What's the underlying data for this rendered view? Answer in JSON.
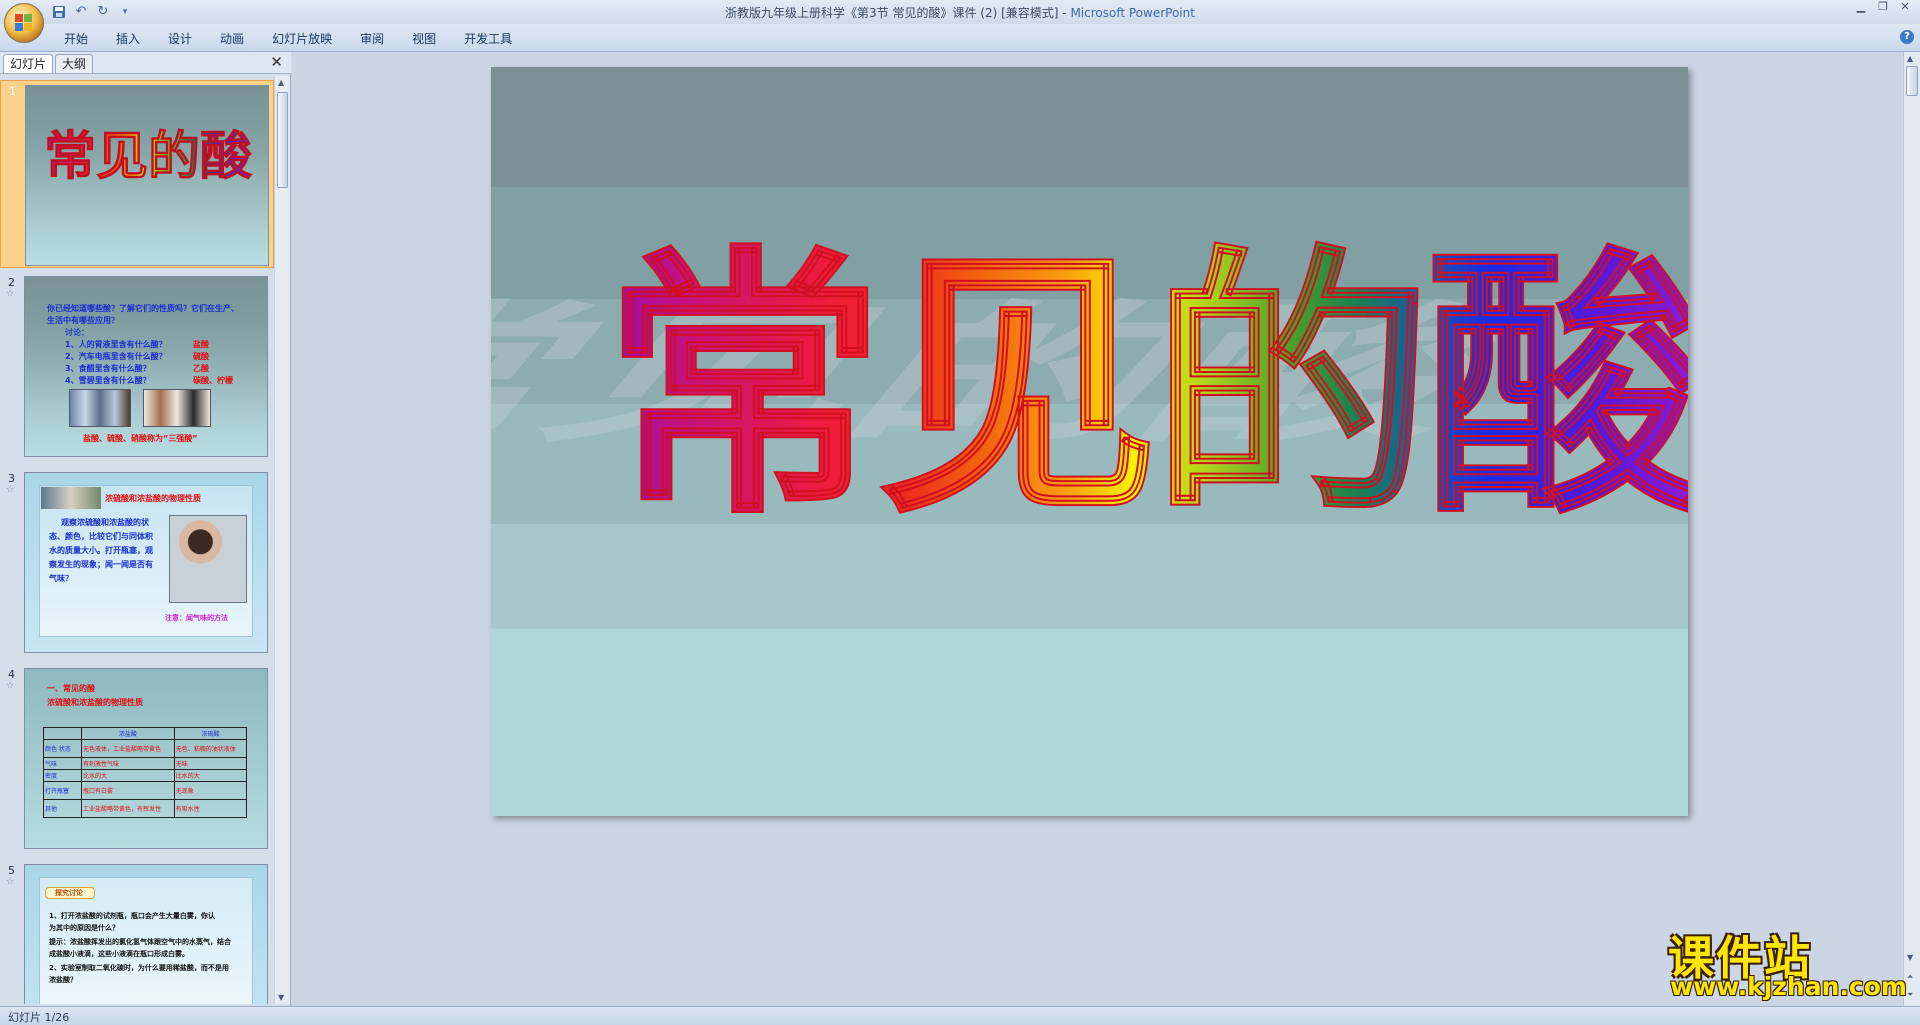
{
  "window": {
    "title": "浙教版九年级上册科学《第3节 常见的酸》课件 (2) [兼容模式] - ",
    "app_name": "Microsoft PowerPoint"
  },
  "ribbon": {
    "tabs": [
      "开始",
      "插入",
      "设计",
      "动画",
      "幻灯片放映",
      "审阅",
      "视图",
      "开发工具"
    ]
  },
  "side_panel": {
    "tab_slides": "幻灯片",
    "tab_outline": "大纲",
    "slides": [
      {
        "number": "1",
        "title": "常见的酸"
      },
      {
        "number": "2",
        "lines": [
          "你已经知道哪些酸？了解它们的性质吗？它们在生产、",
          "生活中有哪些应用？",
          "讨论：",
          "1、人的胃液里含有什么酸？",
          "2、汽车电瓶里含有什么酸？",
          "3、食醋里含有什么酸？",
          "4、雪碧里含有什么酸？"
        ],
        "answers": [
          "盐酸",
          "硫酸",
          "乙酸",
          "碳酸、柠檬"
        ],
        "footer": "盐酸、硫酸、硝酸称为“三强酸”"
      },
      {
        "number": "3",
        "heading": "浓硫酸和浓盐酸的物理性质",
        "lines": [
          "观察浓硫酸和浓盐酸的状",
          "态、颜色，比较它们与同体积",
          "水的质量大小。打开瓶塞，观",
          "察发生的现象；闻一闻是否有",
          "气味？"
        ],
        "footer": "注意：闻气味的方法"
      },
      {
        "number": "4",
        "heading": "一、常见的酸",
        "subheading": "浓硫酸和浓盐酸的物理性质",
        "table": {
          "headers": [
            "",
            "浓盐酸",
            "浓硫酸"
          ],
          "rows": [
            [
              "颜色 状态",
              "无色液体，工业盐酸略带黄色",
              "无色、粘稠的油状液体"
            ],
            [
              "气味",
              "有刺激性气味",
              "无味"
            ],
            [
              "密度",
              "比水的大",
              "比水的大"
            ],
            [
              "打开瓶塞",
              "瓶口有白雾",
              "无现象"
            ],
            [
              "其他",
              "工业盐酸略带黄色，有挥发性",
              "有吸水性"
            ]
          ]
        }
      },
      {
        "number": "5",
        "heading": "探究讨论",
        "lines": [
          "1、打开浓盐酸的试剂瓶，瓶口会产生大量白雾，你认",
          "为其中的原因是什么？",
          "提示：浓盐酸挥发出的氯化氢气体跟空气中的水蒸气，结合",
          "成盐酸小液滴，这些小液滴在瓶口形成白雾。",
          "2、实验室制取二氧化碳时，为什么要用稀盐酸，而不是用",
          "浓盐酸？"
        ]
      }
    ]
  },
  "main_slide": {
    "title": "常见的酸"
  },
  "status_bar": {
    "text": "幻灯片 1/26"
  },
  "watermark": {
    "text_cn": "课件站",
    "text_en": "www.kjzhan.com"
  },
  "colors": {
    "ribbon": "#d6e3f3",
    "selection": "#fad28a",
    "slide_bg": "#8cacaf"
  }
}
